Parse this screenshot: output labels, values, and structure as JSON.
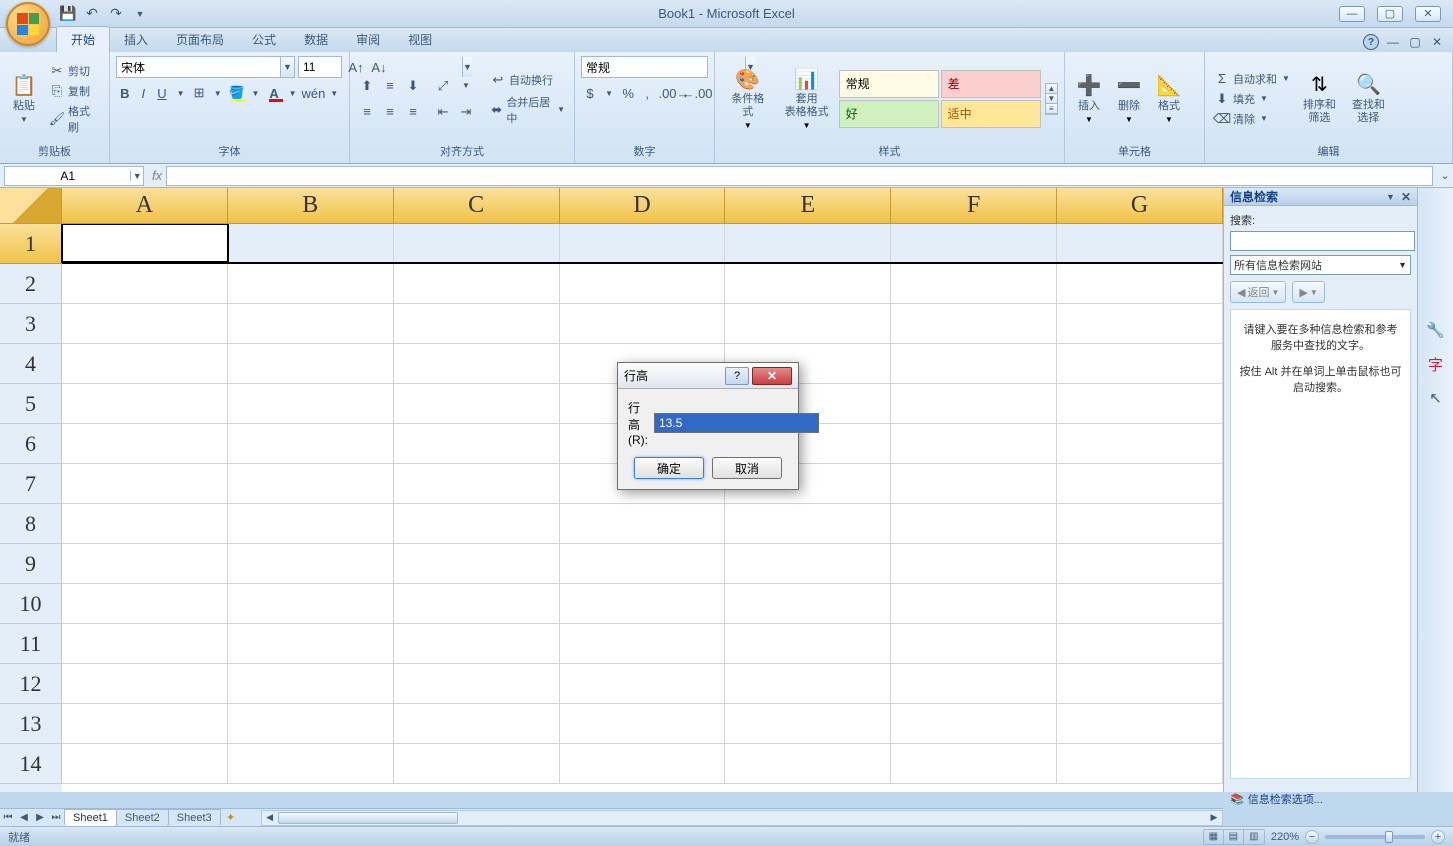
{
  "app": {
    "title": "Book1 - Microsoft Excel"
  },
  "tabs": {
    "items": [
      "开始",
      "插入",
      "页面布局",
      "公式",
      "数据",
      "审阅",
      "视图"
    ],
    "active": "开始"
  },
  "ribbon": {
    "clipboard": {
      "label": "剪贴板",
      "paste": "粘贴",
      "cut": "剪切",
      "copy": "复制",
      "format_painter": "格式刷"
    },
    "font": {
      "label": "字体",
      "name": "宋体",
      "size": "11"
    },
    "alignment": {
      "label": "对齐方式",
      "wrap": "自动换行",
      "merge": "合并后居中"
    },
    "number": {
      "label": "数字",
      "format": "常规"
    },
    "styles": {
      "label": "样式",
      "cond_format": "条件格式",
      "table_format": "套用\n表格格式",
      "gallery": {
        "normal": "常规",
        "bad": "差",
        "good": "好",
        "neutral": "适中"
      }
    },
    "cells": {
      "label": "单元格",
      "insert": "插入",
      "delete": "删除",
      "format": "格式"
    },
    "editing": {
      "label": "编辑",
      "autosum": "自动求和",
      "fill": "填充",
      "clear": "清除",
      "sort_filter": "排序和\n筛选",
      "find_select": "查找和\n选择"
    }
  },
  "formula_bar": {
    "name_box": "A1",
    "fx": "fx"
  },
  "grid": {
    "columns": [
      "A",
      "B",
      "C",
      "D",
      "E",
      "F",
      "G"
    ],
    "rows": [
      "1",
      "2",
      "3",
      "4",
      "5",
      "6",
      "7",
      "8",
      "9",
      "10",
      "11",
      "12",
      "13",
      "14"
    ],
    "selected_row": 1,
    "active_cell": "A1"
  },
  "sheets": {
    "items": [
      "Sheet1",
      "Sheet2",
      "Sheet3"
    ],
    "active": "Sheet1"
  },
  "research": {
    "title": "信息检索",
    "search_label": "搜索:",
    "source": "所有信息检索网站",
    "back": "返回",
    "msg1": "请键入要在多种信息检索和参考服务中查找的文字。",
    "msg2": "按住 Alt 并在单词上单击鼠标也可启动搜索。",
    "options": "信息检索选项..."
  },
  "dialog": {
    "title": "行高",
    "field_label": "行高(R):",
    "value": "13.5",
    "ok": "确定",
    "cancel": "取消"
  },
  "status": {
    "ready": "就绪",
    "zoom": "220%"
  }
}
